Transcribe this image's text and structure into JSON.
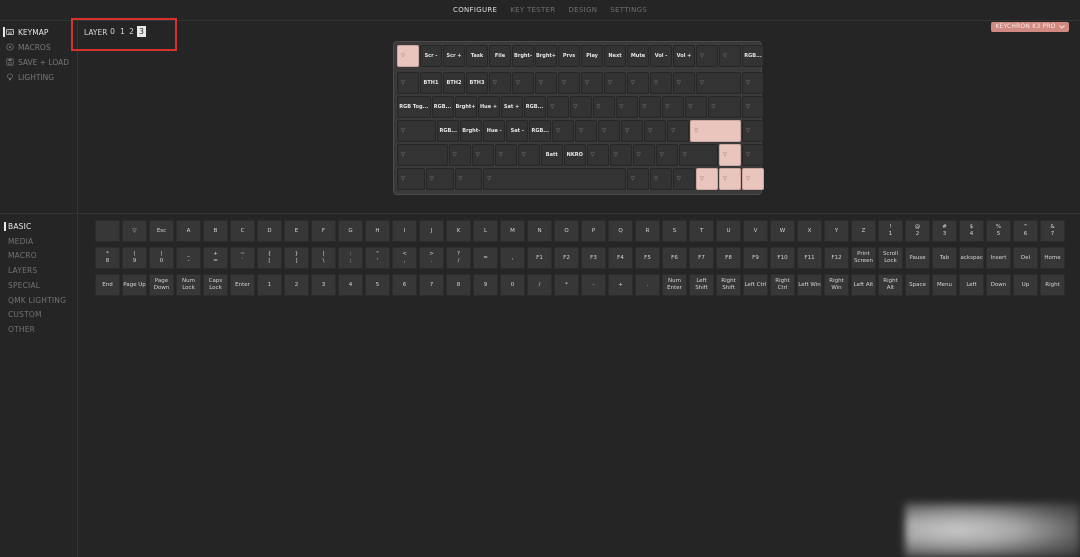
{
  "nav": {
    "tabs": [
      {
        "label": "CONFIGURE",
        "active": true
      },
      {
        "label": "KEY TESTER",
        "active": false
      },
      {
        "label": "DESIGN",
        "active": false
      },
      {
        "label": "SETTINGS",
        "active": false
      }
    ]
  },
  "side_menu": [
    {
      "label": "KEYMAP",
      "icon": "keyboard-icon",
      "active": true
    },
    {
      "label": "MACROS",
      "icon": "circle-icon",
      "active": false
    },
    {
      "label": "SAVE + LOAD",
      "icon": "floppy-icon",
      "active": false
    },
    {
      "label": "LIGHTING",
      "icon": "bulb-icon",
      "active": false
    }
  ],
  "layer": {
    "label": "LAYER",
    "options": [
      "0",
      "1",
      "2",
      "3"
    ],
    "active": "3"
  },
  "keyboard_badge": {
    "label": "KEYCHRON K3 PRO"
  },
  "keymap_rows": [
    [
      "▽",
      "Scr -",
      "Scr +",
      "Task",
      "File",
      "Brght-",
      "Brght+",
      "Prvs",
      "Play",
      "Next",
      "Mute",
      "Vol -",
      "Vol +",
      "▽",
      "▽",
      "RGB..."
    ],
    [
      "▽",
      "BTH1",
      "BTH2",
      "BTH3",
      "▽",
      "▽",
      "▽",
      "▽",
      "▽",
      "▽",
      "▽",
      "▽",
      "▽",
      "▽",
      "▽"
    ],
    [
      "RGB Tog...",
      "RGB...",
      "Brght+",
      "Hue +",
      "Sat +",
      "RGB...",
      "▽",
      "▽",
      "▽",
      "▽",
      "▽",
      "▽",
      "▽",
      "▽",
      "▽"
    ],
    [
      "▽",
      "RGB...",
      "Brght-",
      "Hue -",
      "Sat -",
      "RGB...",
      "▽",
      "▽",
      "▽",
      "▽",
      "▽",
      "▽",
      "▽",
      "▽"
    ],
    [
      "▽",
      "▽",
      "▽",
      "▽",
      "▽",
      "Batt",
      "NKRO",
      "▽",
      "▽",
      "▽",
      "▽",
      "▽",
      "▽",
      "▽"
    ],
    [
      "▽",
      "▽",
      "▽",
      "▽",
      "▽",
      "▽",
      "▽",
      "▽",
      "▽",
      "▽"
    ]
  ],
  "categories": [
    {
      "label": "BASIC",
      "active": true
    },
    {
      "label": "MEDIA",
      "active": false
    },
    {
      "label": "MACRO",
      "active": false
    },
    {
      "label": "LAYERS",
      "active": false
    },
    {
      "label": "SPECIAL",
      "active": false
    },
    {
      "label": "QMK LIGHTING",
      "active": false
    },
    {
      "label": "CUSTOM",
      "active": false
    },
    {
      "label": "OTHER",
      "active": false
    }
  ],
  "picker_rows": [
    [
      "",
      "▽",
      "Esc",
      "A",
      "B",
      "C",
      "D",
      "E",
      "F",
      "G",
      "H",
      "I",
      "J",
      "K",
      "L",
      "M",
      "N",
      "O",
      "P",
      "Q",
      "R",
      "S",
      "T",
      "U",
      "V",
      "W",
      "X",
      "Y",
      "Z",
      "!\n1",
      "@\n2",
      "#\n3",
      "$\n4",
      "%\n5",
      "^\n6",
      "&\n7"
    ],
    [
      "*\n8",
      "(\n9",
      ")\n0",
      "_\n-",
      "+\n=",
      "~\n`",
      "{\n[",
      "}\n]",
      "|\n\\",
      ":\n;",
      "\"\n'",
      "<\n,",
      ">\n.",
      "?\n/",
      "=",
      ",",
      "F1",
      "F2",
      "F3",
      "F4",
      "F5",
      "F6",
      "F7",
      "F8",
      "F9",
      "F10",
      "F11",
      "F12",
      "Print\nScreen",
      "Scroll\nLock",
      "Pause",
      "Tab",
      "Backspace",
      "Insert",
      "Del",
      "Home"
    ],
    [
      "End",
      "Page Up",
      "Page\nDown",
      "Num\nLock",
      "Caps\nLock",
      "Enter",
      "1",
      "2",
      "3",
      "4",
      "5",
      "6",
      "7",
      "8",
      "9",
      "0",
      "/",
      "*",
      "-",
      "+",
      ".",
      "Num\nEnter",
      "Left\nShift",
      "Right\nShift",
      "Left Ctrl",
      "Right\nCtrl",
      "Left Win",
      "Right\nWin",
      "Left Alt",
      "Right Alt",
      "Space",
      "Menu",
      "Left",
      "Down",
      "Up",
      "Right"
    ]
  ]
}
